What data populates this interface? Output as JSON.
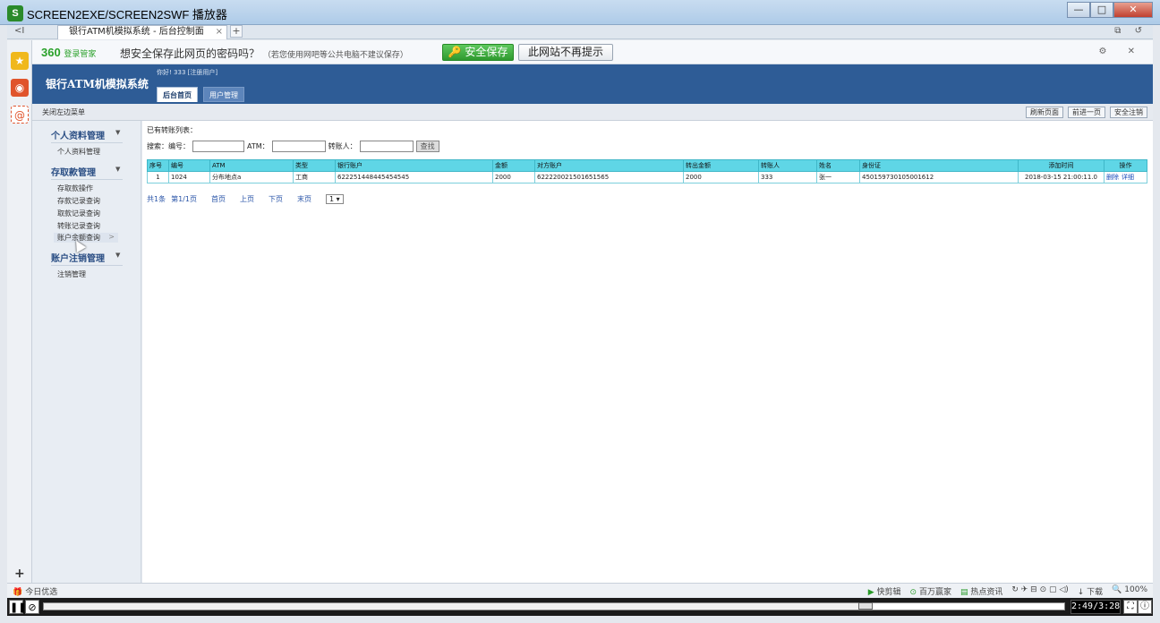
{
  "window": {
    "title": "SCREEN2EXE/SCREEN2SWF 播放器",
    "minimize": "—",
    "maximize": "□",
    "close": "✕"
  },
  "browser": {
    "back": "<I",
    "tab_title": "银行ATM机模拟系统 - 后台控制面",
    "tab_close": "×",
    "new_tab": "+",
    "right_icons": "⧉ ↺",
    "sidebar_plus": "+"
  },
  "pwbar": {
    "logo": "360",
    "logo_sub": "登录管家",
    "question": "想安全保存此网页的密码吗？",
    "hint": "（若您使用网吧等公共电脑不建议保存）",
    "save_button": "安全保存",
    "nomore_button": "此网站不再提示",
    "right_icons": "⚙ ✕"
  },
  "app": {
    "brand": "银行ATM机模拟系统",
    "greeting": "你好! 333 [注册用户]",
    "tabs": [
      "后台首页",
      "用户管理"
    ],
    "close_menu": "关闭左边菜单",
    "top_buttons": [
      "刷新页面",
      "前进一页",
      "安全注销"
    ]
  },
  "menu": {
    "groups": [
      {
        "title": "个人资料管理",
        "items": [
          "个人资料管理"
        ]
      },
      {
        "title": "存取款管理",
        "items": [
          "存取款操作",
          "存款记录查询",
          "取款记录查询",
          "转账记录查询",
          "账户余额查询"
        ]
      },
      {
        "title": "账户注销管理",
        "items": [
          "注销管理"
        ]
      }
    ],
    "arrow": "▼",
    "chevron": ">"
  },
  "main": {
    "caption": "已有转账列表：",
    "search": {
      "label_search": "搜索：",
      "label_no": "编号：",
      "label_atm": "ATM：",
      "label_transfer": "转账人：",
      "button": "查找"
    },
    "table": {
      "headers": [
        "序号",
        "编号",
        "ATM",
        "类型",
        "银行账户",
        "金额",
        "对方账户",
        "转出金额",
        "转账人",
        "姓名",
        "身份证",
        "添加时间",
        "操作"
      ],
      "rows": [
        [
          "1",
          "1024",
          "分布地点a",
          "工商",
          "622251448445454545",
          "2000",
          "622220021501651565",
          "2000",
          "333",
          "张一",
          "450159730105001612",
          "2018-03-15 21:00:11.0"
        ]
      ],
      "ops": [
        "删除",
        "详细"
      ]
    },
    "pager": {
      "total": "共1条",
      "page": "第1/1页",
      "first": "首页",
      "prev": "上页",
      "next": "下页",
      "last": "末页",
      "select": "1 ▾"
    }
  },
  "statusbar": {
    "today": "今日优选",
    "items": [
      "快剪辑",
      "百万赢家",
      "热点资讯",
      "下载",
      "100%"
    ],
    "icons": "↻ ✈ ⊟ ⊙ ▢ ◁)"
  },
  "player": {
    "pause": "❚❚",
    "stop": "⊘",
    "time": "2:49/3:28",
    "fullscreen": "⛶",
    "info": "ⓘ",
    "progress_fraction": 0.81
  }
}
